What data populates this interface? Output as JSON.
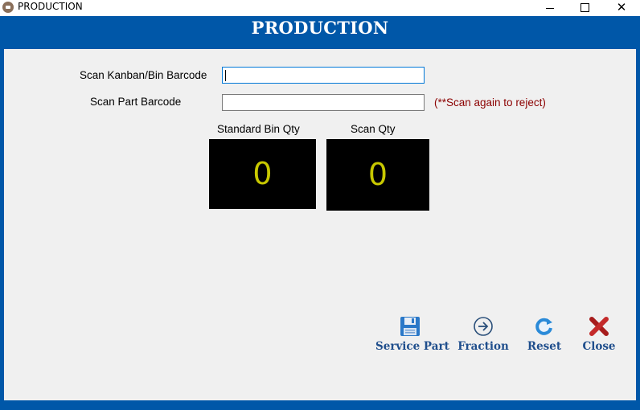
{
  "window": {
    "title": "PRODUCTION",
    "min_glyph": "",
    "max_glyph": "",
    "close_glyph": "✕"
  },
  "header": {
    "title": "PRODUCTION"
  },
  "form": {
    "kanban_label": "Scan Kanban/Bin Barcode",
    "kanban_value": "",
    "part_label": "Scan Part Barcode",
    "part_value": "",
    "reject_hint": "(**Scan again to reject)"
  },
  "quantities": {
    "standard_bin_label": "Standard Bin Qty",
    "standard_bin_value": "0",
    "scan_qty_label": "Scan Qty",
    "scan_qty_value": "0"
  },
  "toolbar": {
    "service_part": {
      "label": "Service Part",
      "icon": "floppy-disk-icon"
    },
    "fraction": {
      "label": "Fraction",
      "icon": "arrow-right-circle-icon"
    },
    "reset": {
      "label": "Reset",
      "icon": "refresh-icon"
    },
    "close": {
      "label": "Close",
      "icon": "red-x-icon"
    }
  },
  "colors": {
    "frame_blue": "#0057a8",
    "panel_gray": "#f0f0f0",
    "qty_bg": "#000000",
    "qty_text": "#c8c800",
    "hint_red": "#8b0000",
    "button_text": "#1f4e8c"
  }
}
